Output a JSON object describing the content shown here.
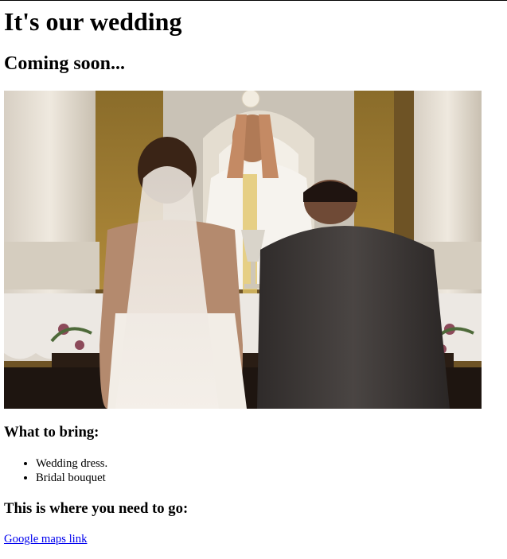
{
  "heading": "It's our wedding",
  "subheading": "Coming soon...",
  "photo": {
    "icon": "wedding-ceremony-photo"
  },
  "bring": {
    "title": "What to bring:",
    "items": [
      "Wedding dress.",
      "Bridal bouquet"
    ]
  },
  "directions": {
    "title": "This is where you need to go:",
    "link_text": "Google maps link"
  },
  "colors": {
    "link": "#0000ee",
    "text": "#000000",
    "background": "#ffffff"
  }
}
